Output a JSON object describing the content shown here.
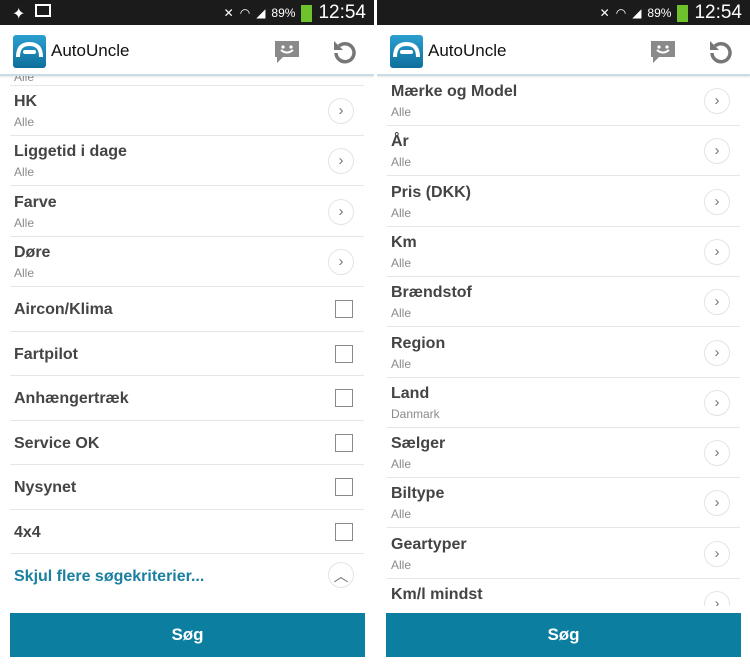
{
  "status": {
    "battery": "89%",
    "time": "12:54"
  },
  "app": {
    "title": "AutoUncle"
  },
  "left": {
    "partial_sub": "Alle",
    "nav_rows": [
      {
        "title": "HK",
        "sub": "Alle"
      },
      {
        "title": "Liggetid i dage",
        "sub": "Alle"
      },
      {
        "title": "Farve",
        "sub": "Alle"
      },
      {
        "title": "Døre",
        "sub": "Alle"
      }
    ],
    "check_rows": [
      {
        "title": "Aircon/Klima",
        "checked": false
      },
      {
        "title": "Fartpilot",
        "checked": false
      },
      {
        "title": "Anhængertræk",
        "checked": false
      },
      {
        "title": "Service OK",
        "checked": false
      },
      {
        "title": "Nysynet",
        "checked": false
      },
      {
        "title": "4x4",
        "checked": false
      }
    ],
    "toggle_link": "Skjul flere søgekriterier...",
    "search": "Søg"
  },
  "right": {
    "nav_rows": [
      {
        "title": "Mærke og Model",
        "sub": "Alle"
      },
      {
        "title": "År",
        "sub": "Alle"
      },
      {
        "title": "Pris (DKK)",
        "sub": "Alle"
      },
      {
        "title": "Km",
        "sub": "Alle"
      },
      {
        "title": "Brændstof",
        "sub": "Alle"
      },
      {
        "title": "Region",
        "sub": "Alle"
      },
      {
        "title": "Land",
        "sub": "Danmark"
      },
      {
        "title": "Sælger",
        "sub": "Alle"
      },
      {
        "title": "Biltype",
        "sub": "Alle"
      },
      {
        "title": "Geartyper",
        "sub": "Alle"
      },
      {
        "title": "Km/l mindst",
        "sub": ""
      }
    ],
    "search": "Søg"
  },
  "colors": {
    "accent": "#0c7fa1",
    "status_bar": "#1b1b1b",
    "battery": "#6ec22c"
  }
}
